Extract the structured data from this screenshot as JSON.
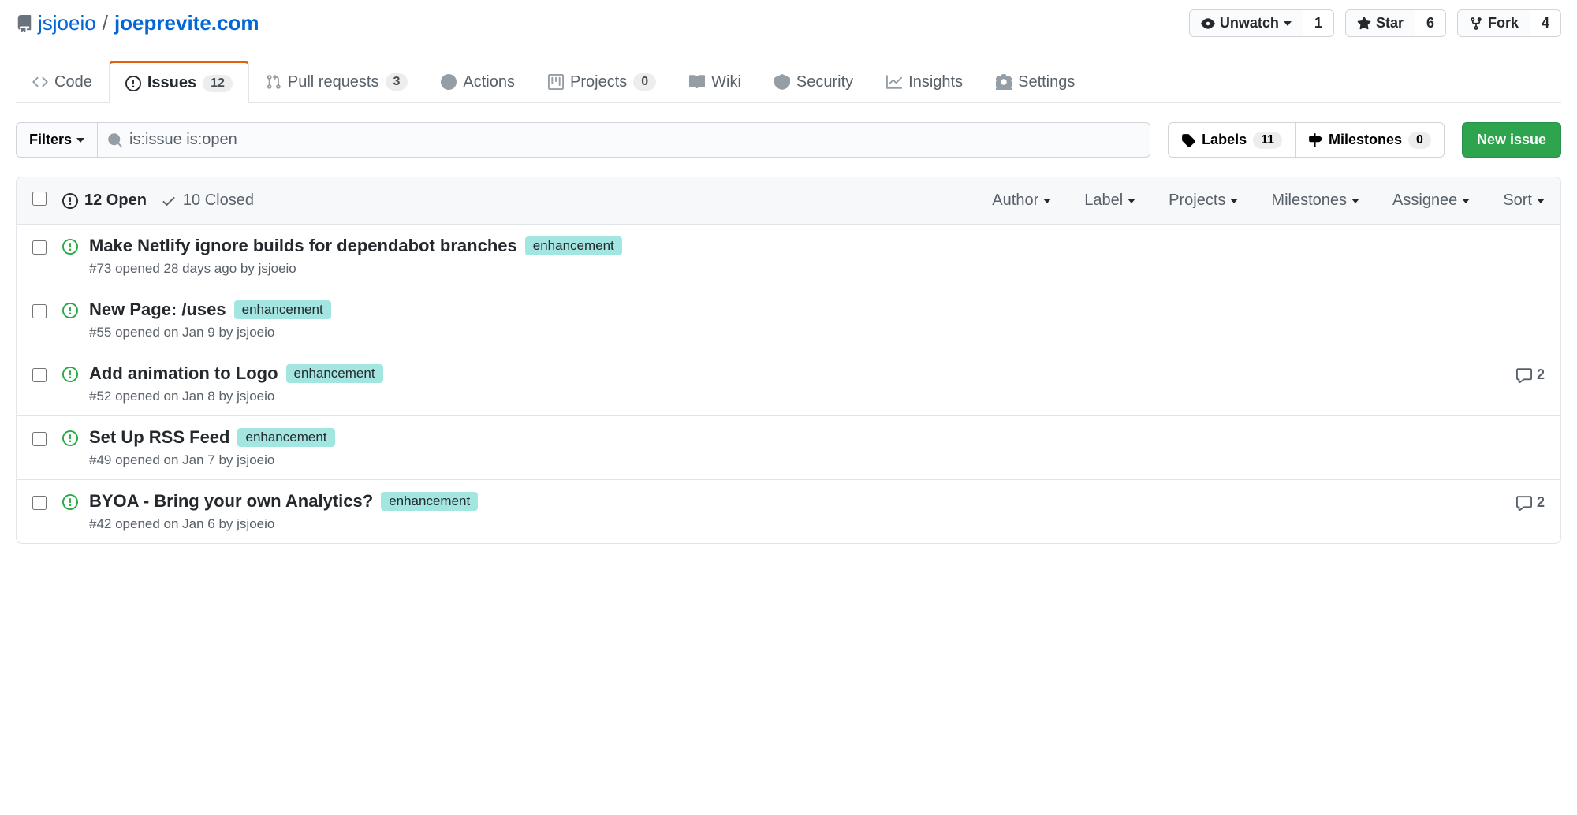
{
  "repo": {
    "owner": "jsjoeio",
    "name": "joeprevite.com"
  },
  "actions": {
    "watch": {
      "label": "Unwatch",
      "count": "1"
    },
    "star": {
      "label": "Star",
      "count": "6"
    },
    "fork": {
      "label": "Fork",
      "count": "4"
    }
  },
  "tabs": {
    "code": "Code",
    "issues": {
      "label": "Issues",
      "count": "12"
    },
    "pulls": {
      "label": "Pull requests",
      "count": "3"
    },
    "actions": "Actions",
    "projects": {
      "label": "Projects",
      "count": "0"
    },
    "wiki": "Wiki",
    "security": "Security",
    "insights": "Insights",
    "settings": "Settings"
  },
  "toolbar": {
    "filters_label": "Filters",
    "search_value": "is:issue is:open",
    "labels": {
      "label": "Labels",
      "count": "11"
    },
    "milestones": {
      "label": "Milestones",
      "count": "0"
    },
    "new_issue": "New issue"
  },
  "list_header": {
    "open": "12 Open",
    "closed": "10 Closed",
    "filters": [
      "Author",
      "Label",
      "Projects",
      "Milestones",
      "Assignee",
      "Sort"
    ]
  },
  "labels": {
    "enhancement": {
      "text": "enhancement",
      "bg": "#a3e5e0"
    }
  },
  "issues": [
    {
      "title": "Make Netlify ignore builds for dependabot branches",
      "label": "enhancement",
      "meta": "#73 opened 28 days ago by jsjoeio",
      "comments": null
    },
    {
      "title": "New Page: /uses",
      "label": "enhancement",
      "meta": "#55 opened on Jan 9 by jsjoeio",
      "comments": null
    },
    {
      "title": "Add animation to Logo",
      "label": "enhancement",
      "meta": "#52 opened on Jan 8 by jsjoeio",
      "comments": "2"
    },
    {
      "title": "Set Up RSS Feed",
      "label": "enhancement",
      "meta": "#49 opened on Jan 7 by jsjoeio",
      "comments": null
    },
    {
      "title": "BYOA - Bring your own Analytics?",
      "label": "enhancement",
      "meta": "#42 opened on Jan 6 by jsjoeio",
      "comments": "2"
    }
  ]
}
